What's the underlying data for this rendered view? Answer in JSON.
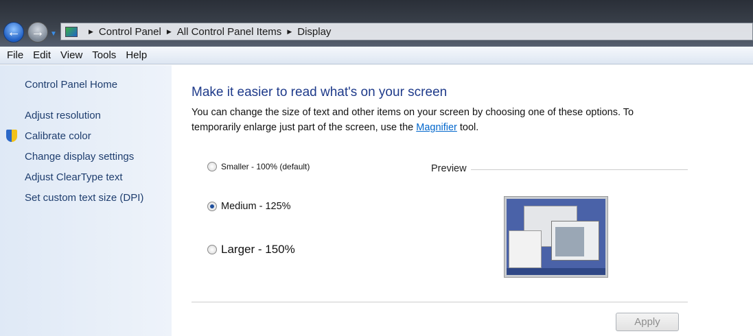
{
  "breadcrumb": [
    "Control Panel",
    "All Control Panel Items",
    "Display"
  ],
  "menu": [
    "File",
    "Edit",
    "View",
    "Tools",
    "Help"
  ],
  "sidebar": {
    "home": "Control Panel Home",
    "links": [
      "Adjust resolution",
      "Calibrate color",
      "Change display settings",
      "Adjust ClearType text",
      "Set custom text size (DPI)"
    ]
  },
  "main": {
    "title": "Make it easier to read what's on your screen",
    "desc1": "You can change the size of text and other items on your screen by choosing one of these options. To temporarily enlarge just part of the screen, use the ",
    "link": "Magnifier",
    "desc2": " tool.",
    "options": [
      "Smaller - 100% (default)",
      "Medium - 125%",
      "Larger - 150%"
    ],
    "selected": "Medium - 125%",
    "preview": "Preview",
    "apply": "Apply"
  }
}
